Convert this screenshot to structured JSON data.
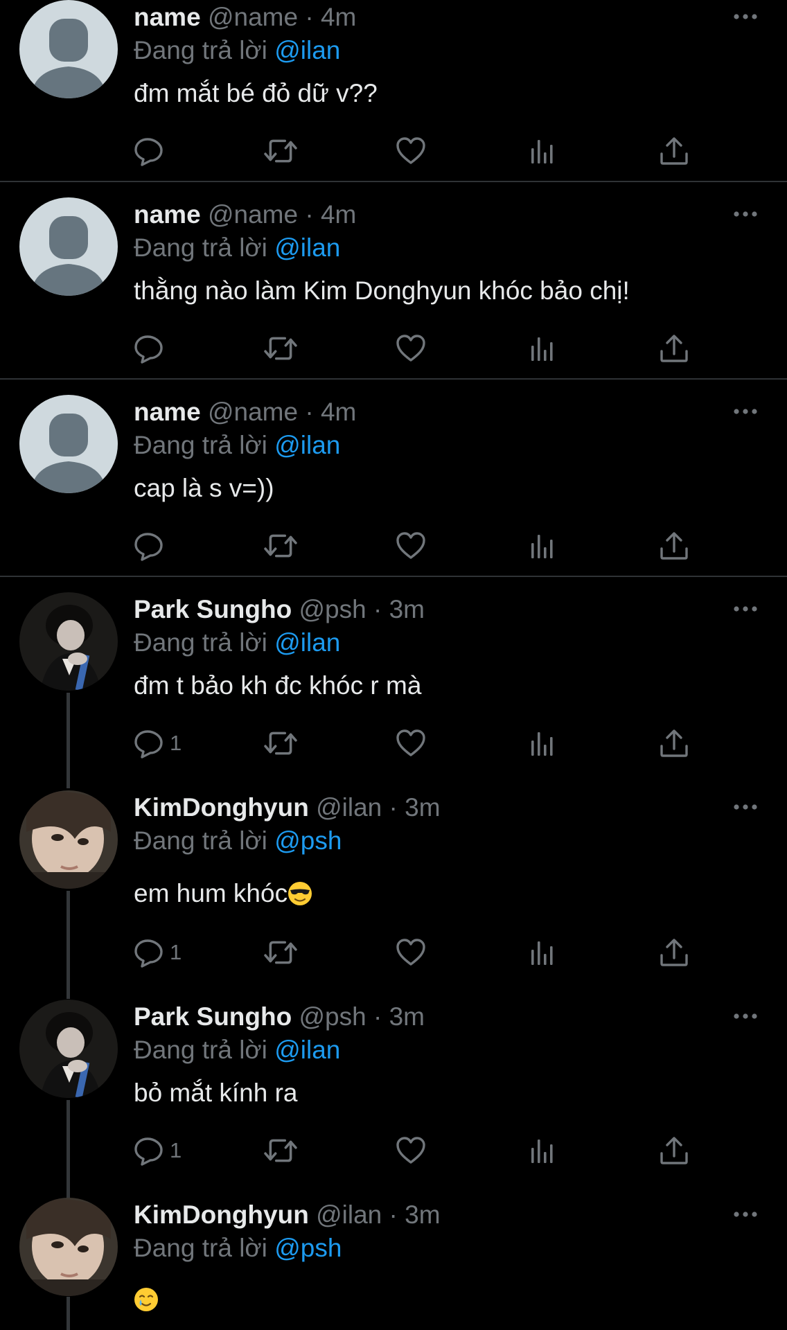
{
  "reply_prefix": "Đang trả lời",
  "colors": {
    "background": "#000000",
    "text": "#e7e9ea",
    "secondary": "#71767b",
    "accent": "#1d9bf0",
    "separator": "#2f3336"
  },
  "tweets": [
    {
      "display_name": "name",
      "handle": "@name",
      "time": "4m",
      "reply_to": "@ilan",
      "text": "đm mắt bé đỏ dữ v??",
      "reply_count": "",
      "avatar": "default-avatar"
    },
    {
      "display_name": "name",
      "handle": "@name",
      "time": "4m",
      "reply_to": "@ilan",
      "text": "thằng nào làm Kim Donghyun khóc bảo chị!",
      "reply_count": "",
      "avatar": "default-avatar"
    },
    {
      "display_name": "name",
      "handle": "@name",
      "time": "4m",
      "reply_to": "@ilan",
      "text": "cap là s v=))",
      "reply_count": "",
      "avatar": "default-avatar"
    },
    {
      "display_name": "Park Sungho",
      "handle": "@psh",
      "time": "3m",
      "reply_to": "@ilan",
      "text": "đm t bảo kh đc khóc r mà",
      "reply_count": "1",
      "avatar": "photo-avatar"
    },
    {
      "display_name": "KimDonghyun",
      "handle": "@ilan",
      "time": "3m",
      "reply_to": "@psh",
      "text": "em hum khóc",
      "emoji": "sunglasses-emoji",
      "reply_count": "1",
      "avatar": "photo-avatar"
    },
    {
      "display_name": "Park Sungho",
      "handle": "@psh",
      "time": "3m",
      "reply_to": "@ilan",
      "text": "bỏ mắt kính ra",
      "reply_count": "1",
      "avatar": "photo-avatar"
    },
    {
      "display_name": "KimDonghyun",
      "handle": "@ilan",
      "time": "3m",
      "reply_to": "@psh",
      "text": "",
      "emoji": "crying-smile-emoji",
      "reply_count": "",
      "avatar": "photo-avatar"
    }
  ]
}
